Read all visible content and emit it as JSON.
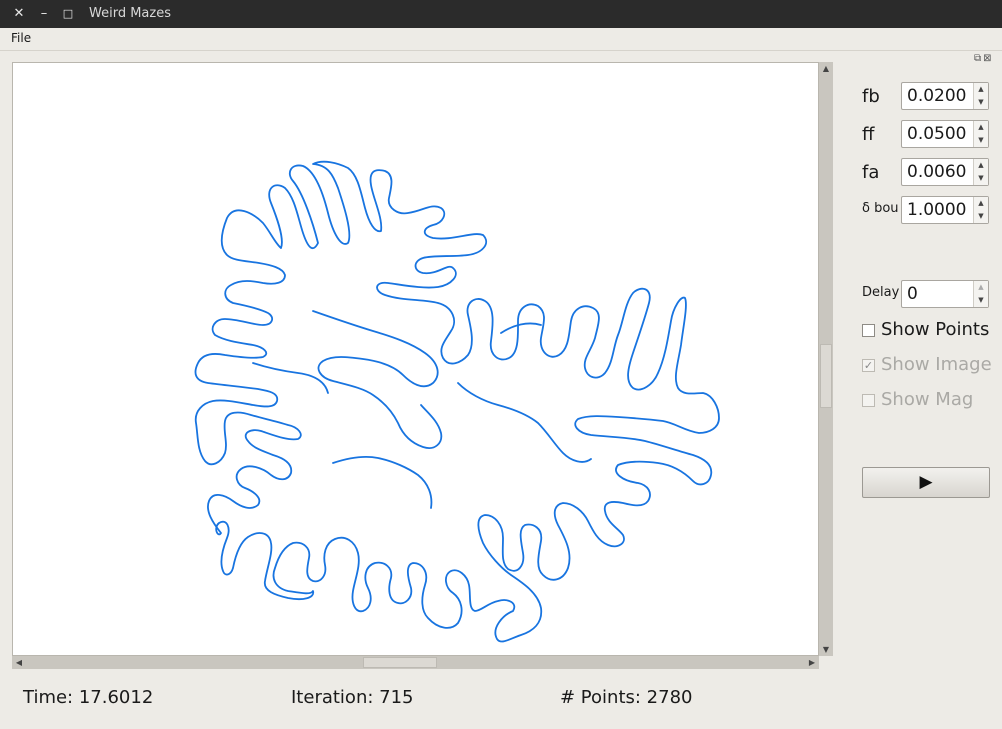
{
  "window": {
    "title": "Weird Mazes",
    "close_glyph": "✕",
    "minimize_glyph": "–",
    "maximize_glyph": "□"
  },
  "menu": {
    "file": "File"
  },
  "canvas": {
    "curve_color": "#1874e0",
    "background": "#ffffff"
  },
  "scroll": {
    "up": "▲",
    "down": "▼",
    "left": "◀",
    "right": "▶"
  },
  "dock": {
    "float_icon": "⧉",
    "close_icon": "⊠"
  },
  "params": [
    {
      "label": "fb",
      "value": "0.0200"
    },
    {
      "label": "ff",
      "value": "0.0500"
    },
    {
      "label": "fa",
      "value": "0.0060"
    },
    {
      "label": "δ bou",
      "value": "1.0000"
    }
  ],
  "delay": {
    "label": "Delay",
    "value": "0"
  },
  "spin_arrows": {
    "up": "▲",
    "down": "▼"
  },
  "checkboxes": {
    "show_points": {
      "label": "Show Points",
      "checked": false,
      "enabled": true
    },
    "show_image": {
      "label": "Show Image",
      "checked": true,
      "enabled": false,
      "mark": "✓"
    },
    "show_mag": {
      "label": "Show Mag",
      "checked": false,
      "enabled": false
    }
  },
  "play_button": {
    "glyph": "▶",
    "icon": "play-icon"
  },
  "status": {
    "time": "Time: 17.6012",
    "iteration": "Iteration: 715",
    "points": "# Points: 2780"
  }
}
